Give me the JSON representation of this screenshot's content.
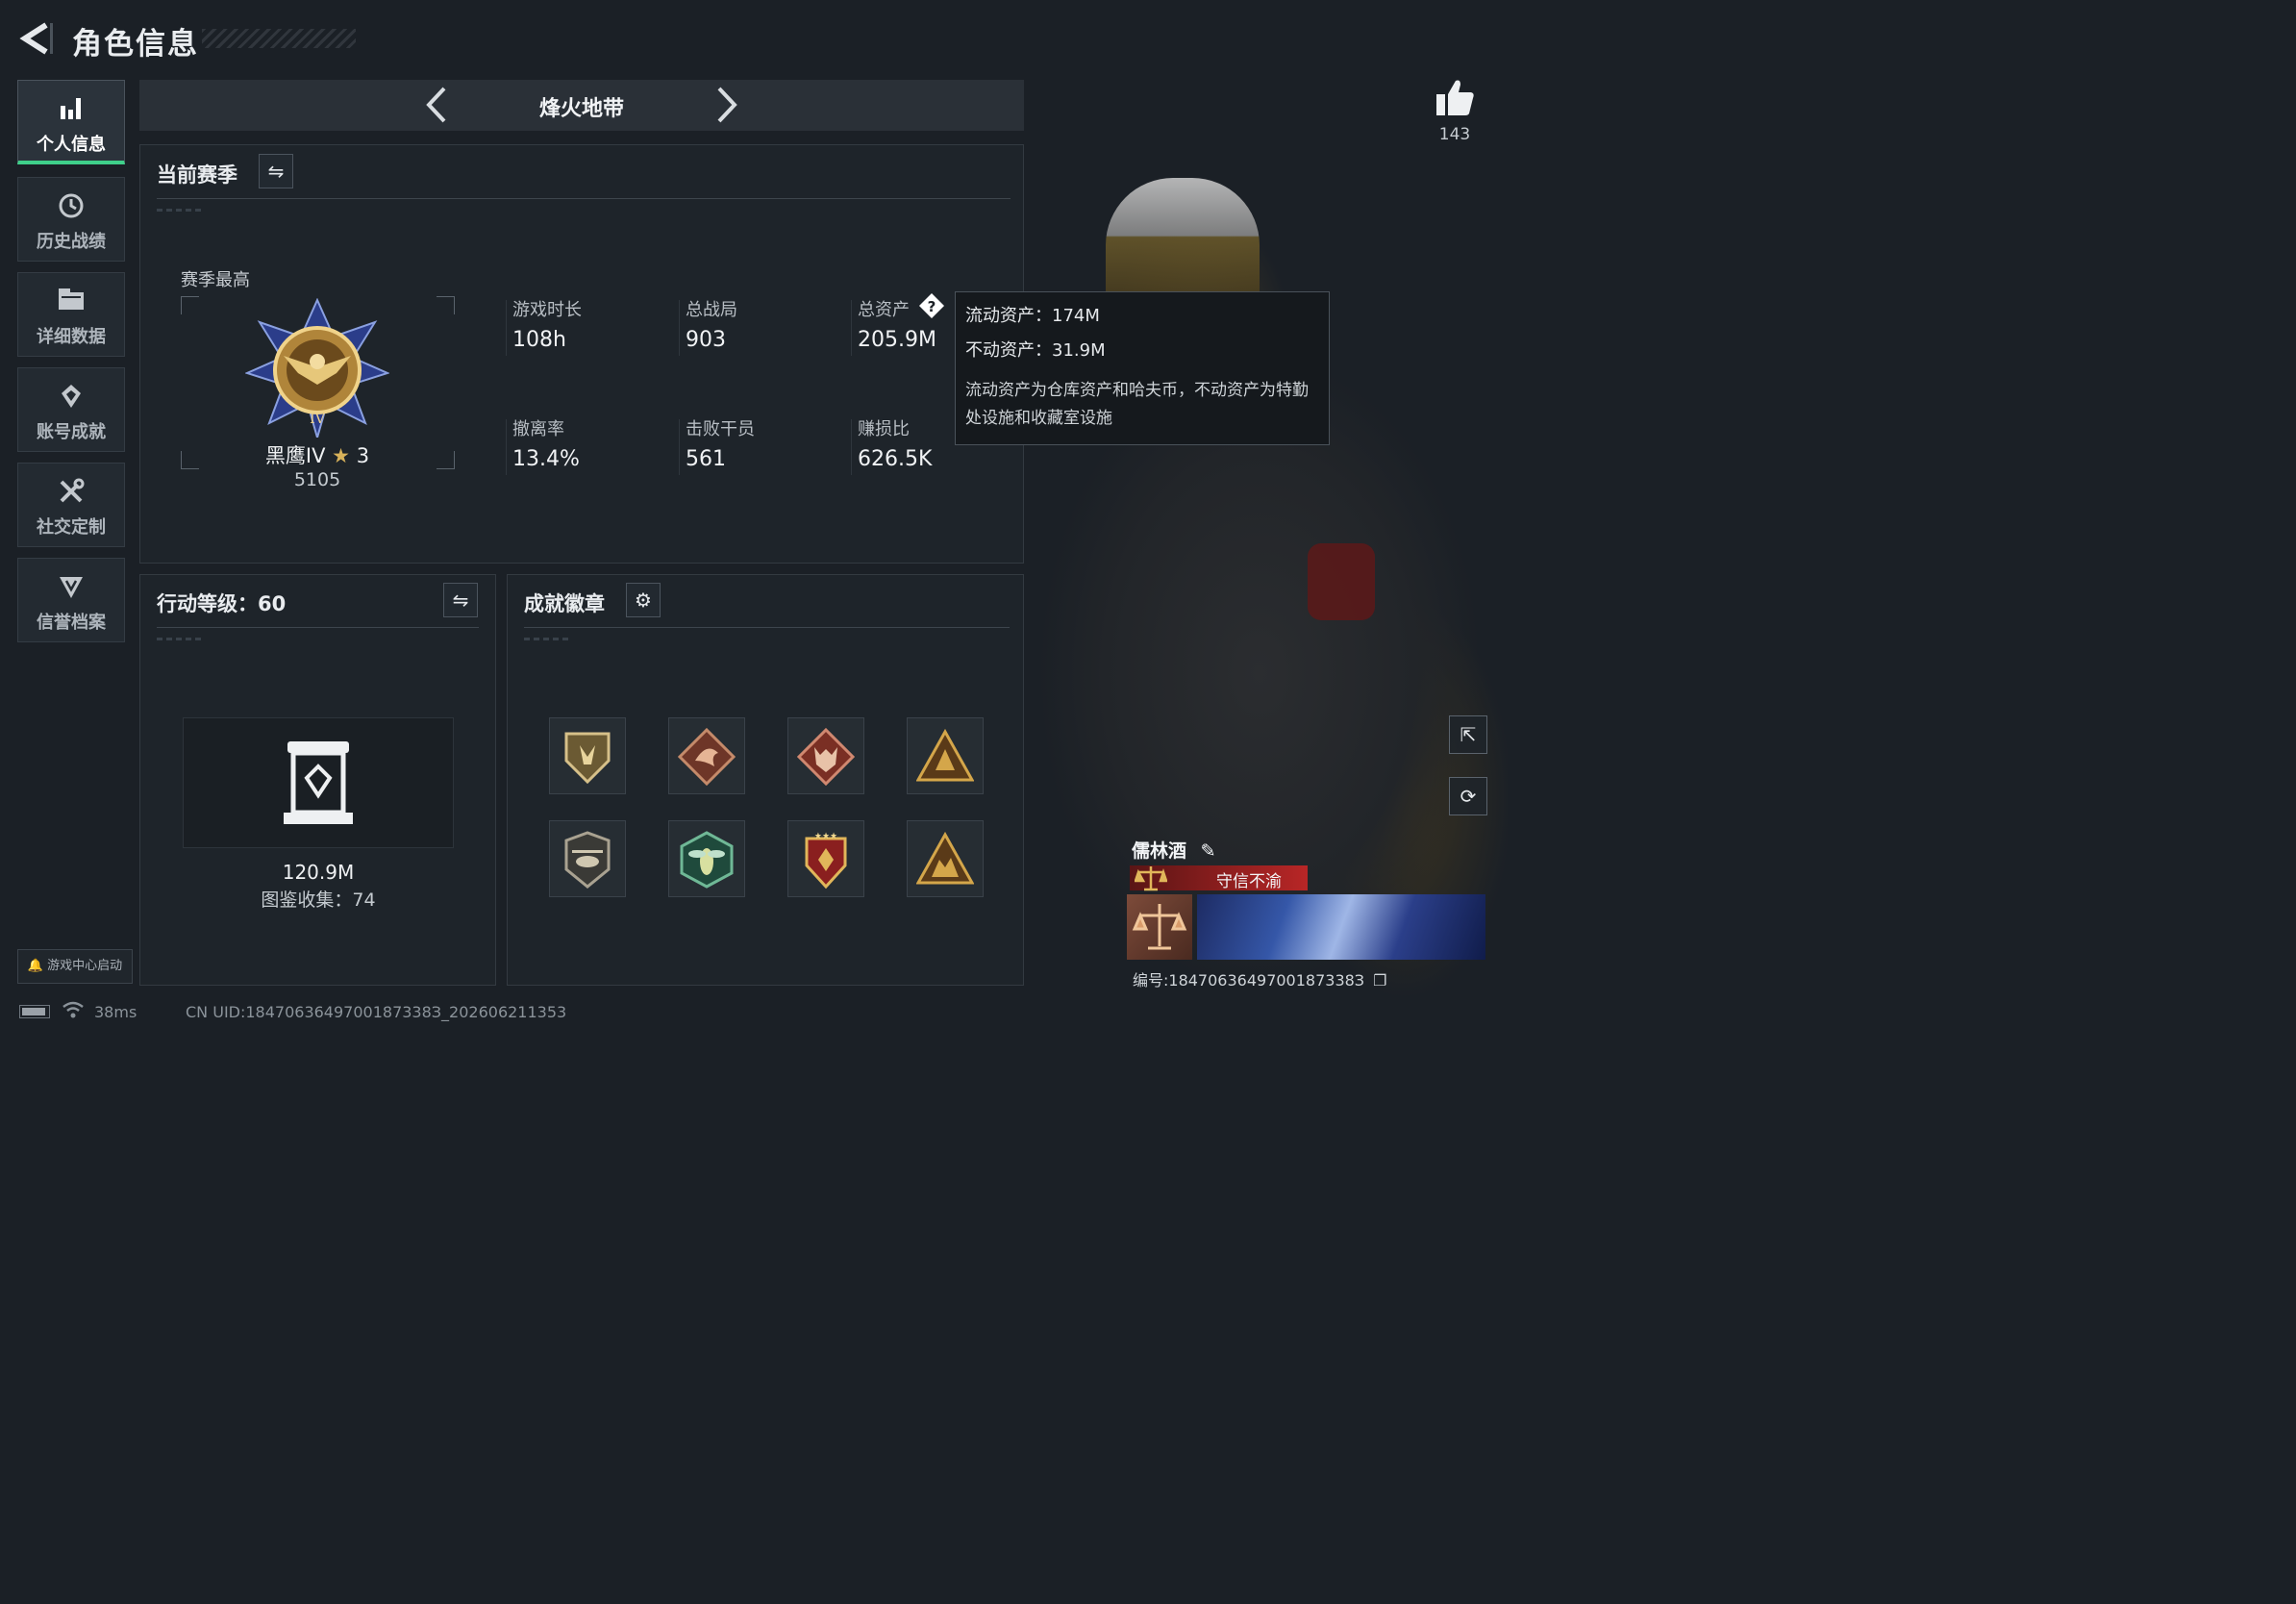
{
  "header": {
    "title": "角色信息"
  },
  "sidebar": {
    "items": [
      {
        "label": "个人信息",
        "icon": "bar-chart-icon",
        "active": true
      },
      {
        "label": "历史战绩",
        "icon": "history-clock-icon"
      },
      {
        "label": "详细数据",
        "icon": "folder-icon"
      },
      {
        "label": "账号成就",
        "icon": "achievement-icon"
      },
      {
        "label": "社交定制",
        "icon": "tools-icon"
      },
      {
        "label": "信誉档案",
        "icon": "shield-icon"
      }
    ],
    "launch_label": "游戏中心启动"
  },
  "mode": {
    "name": "烽火地带"
  },
  "season": {
    "title": "当前赛季",
    "peak_label": "赛季最高",
    "rank_name": "黑鹰IV",
    "rank_stars": "3",
    "rank_score": "5105",
    "stats": [
      {
        "label": "游戏时长",
        "value": "108h"
      },
      {
        "label": "总战局",
        "value": "903"
      },
      {
        "label": "总资产",
        "value": "205.9M"
      },
      {
        "label": "撤离率",
        "value": "13.4%"
      },
      {
        "label": "击败干员",
        "value": "561"
      },
      {
        "label": "赚损比",
        "value": "626.5K"
      }
    ]
  },
  "tooltip": {
    "liquid": "流动资产：174M",
    "fixed": "不动资产：31.9M",
    "desc": "流动资产为仓库资产和哈夫币，不动资产为特勤处设施和收藏室设施"
  },
  "action_level": {
    "title": "行动等级：60",
    "value": "120.9M",
    "collection": "图鉴收集：74"
  },
  "badges": {
    "title": "成就徽章",
    "items": [
      "shield-emblem-icon",
      "dragon-emblem-icon",
      "wolf-emblem-icon",
      "triangle-emblem-icon",
      "helicopter-emblem-icon",
      "hornet-emblem-icon",
      "star-shield-emblem-icon",
      "beast-triangle-emblem-icon"
    ]
  },
  "profile": {
    "likes": "143",
    "name": "儒林酒",
    "honor": "守信不渝",
    "id": "编号:1847063649700187338З"
  },
  "footer": {
    "ping": "38ms",
    "uid": "CN UID:1847063649700187338З_202606211353"
  },
  "colors": {
    "accent_green": "#3fd08a",
    "honor_red": "#b82626",
    "gold": "#c9a24a"
  }
}
